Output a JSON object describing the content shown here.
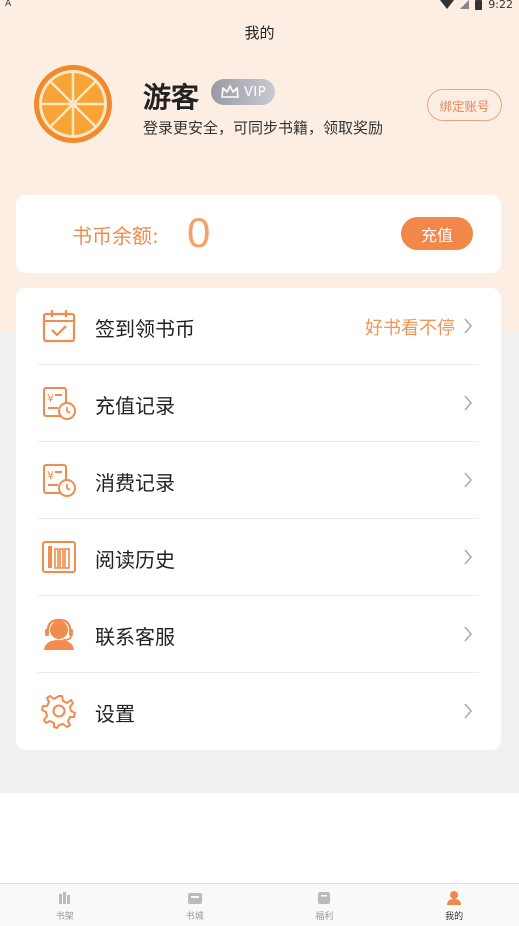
{
  "status_bar": {
    "left_glyph": "A",
    "time": "9:22"
  },
  "header": {
    "title": "我的"
  },
  "profile": {
    "name": "游客",
    "vip_label": "VIP",
    "subtitle": "登录更安全，可同步书籍，领取奖励",
    "bind_label": "绑定账号"
  },
  "coins": {
    "label": "书币余额:",
    "value": "0",
    "recharge_label": "充值"
  },
  "menu": [
    {
      "label": "签到领书币",
      "extra": "好书看不停",
      "icon": "calendar-check-icon"
    },
    {
      "label": "充值记录",
      "extra": "",
      "icon": "recharge-record-icon"
    },
    {
      "label": "消费记录",
      "extra": "",
      "icon": "consume-record-icon"
    },
    {
      "label": "阅读历史",
      "extra": "",
      "icon": "bookshelf-history-icon"
    },
    {
      "label": "联系客服",
      "extra": "",
      "icon": "customer-service-icon"
    },
    {
      "label": "设置",
      "extra": "",
      "icon": "gear-icon"
    }
  ],
  "tabbar": [
    {
      "label": "书架",
      "icon": "bookshelf-icon",
      "active": false
    },
    {
      "label": "书城",
      "icon": "bookstore-icon",
      "active": false
    },
    {
      "label": "福利",
      "icon": "gift-icon",
      "active": false
    },
    {
      "label": "我的",
      "icon": "profile-icon",
      "active": true
    }
  ],
  "colors": {
    "accent": "#f2874a",
    "header_bg": "#fdeee3",
    "page_bg": "#f1f1f1"
  }
}
